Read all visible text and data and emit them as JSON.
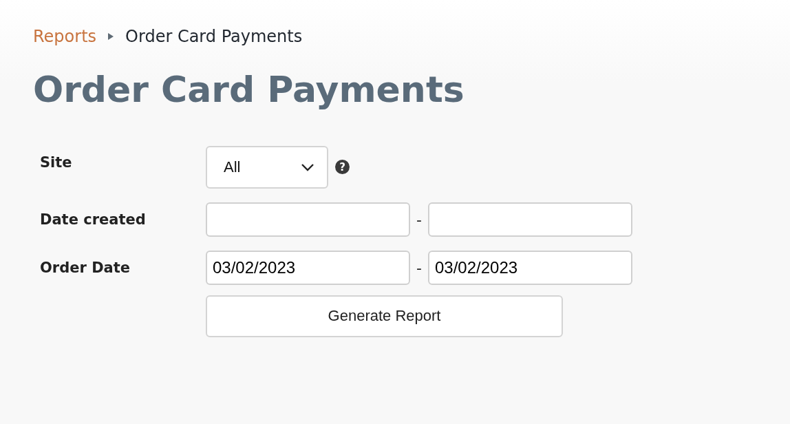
{
  "breadcrumb": {
    "items": [
      {
        "label": "Reports",
        "kind": "link"
      },
      {
        "label": "Order Card Payments",
        "kind": "current"
      }
    ]
  },
  "title": "Order Card Payments",
  "form": {
    "rows": [
      {
        "kind": "select",
        "label": "Site",
        "value": "All",
        "help": "?"
      },
      {
        "kind": "range",
        "label": "Date created",
        "from": "",
        "to": "",
        "separator": "-"
      },
      {
        "kind": "range",
        "label": "Order Date",
        "from": "03/02/2023",
        "to": "03/02/2023",
        "separator": "-"
      }
    ],
    "submit": "Generate Report"
  }
}
